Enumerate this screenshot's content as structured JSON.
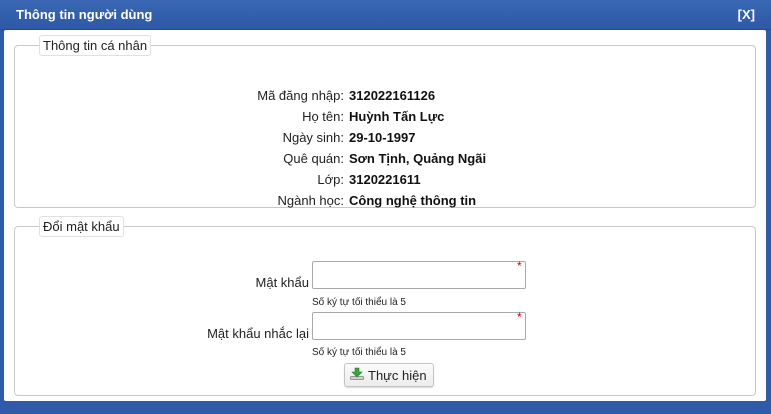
{
  "dialog": {
    "title": "Thông tin người dùng",
    "close_label": "[X]"
  },
  "personal": {
    "legend": "Thông tin cá nhân",
    "fields": [
      {
        "label": "Mã đăng nhập:",
        "value": "312022161126"
      },
      {
        "label": "Họ tên:",
        "value": "Huỳnh Tấn Lực"
      },
      {
        "label": "Ngày sinh:",
        "value": "29-10-1997"
      },
      {
        "label": "Quê quán:",
        "value": "Sơn Tịnh, Quảng Ngãi"
      },
      {
        "label": "Lớp:",
        "value": "3120221611"
      },
      {
        "label": "Ngành học:",
        "value": "Công nghệ thông tin"
      }
    ]
  },
  "password": {
    "legend": "Đổi mật khẩu",
    "new_label": "Mật khẩu",
    "new_value": "",
    "new_hint": "Số ký tự tối thiểu là 5",
    "confirm_label": "Mật khẩu nhắc lại",
    "confirm_value": "",
    "confirm_hint": "Số ký tự tối thiểu là 5",
    "required_mark": "*",
    "submit_label": "Thực hiện",
    "submit_icon": "download-arrow-icon"
  },
  "colors": {
    "titlebar": "#2f5ba8",
    "required": "#d40000"
  }
}
